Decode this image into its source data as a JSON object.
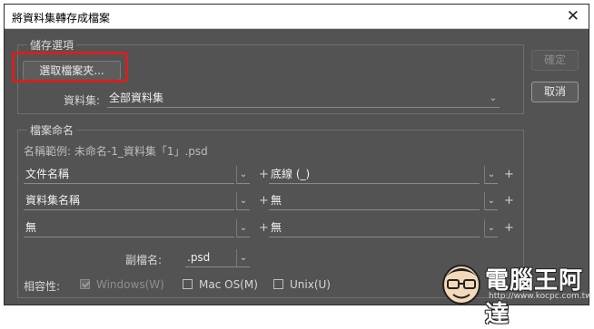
{
  "window": {
    "title": "將資料集轉存成檔案"
  },
  "save_options": {
    "legend": "儲存選項",
    "select_folder_label": "選取檔案夾...",
    "dataset_label": "資料集:",
    "dataset_value": "全部資料集"
  },
  "buttons": {
    "ok": "確定",
    "cancel": "取消"
  },
  "file_naming": {
    "legend": "檔案命名",
    "example": "名稱範例: 未命名-1_資料集「1」.psd",
    "rows": [
      {
        "left": "文件名稱",
        "right": "底線 (_)"
      },
      {
        "left": "資料集名稱",
        "right": "無"
      },
      {
        "left": "無",
        "right": "無"
      }
    ],
    "plus_sign": "+",
    "extension_label": "副檔名:",
    "extension_value": ".psd",
    "compat_label": "相容性:",
    "compat_options": [
      {
        "label": "Windows(W)",
        "checked": true,
        "disabled": true
      },
      {
        "label": "Mac OS(M)",
        "checked": false,
        "disabled": false
      },
      {
        "label": "Unix(U)",
        "checked": false,
        "disabled": false
      }
    ]
  },
  "watermark": {
    "title": "電腦王阿達",
    "url": "http://www.kocpc.com.tw"
  },
  "colors": {
    "highlight": "#d32121",
    "panel": "#535353",
    "titlebar": "#ffffff"
  },
  "icons": {
    "close": "close-icon",
    "dropdown": "chevron-down-icon"
  }
}
